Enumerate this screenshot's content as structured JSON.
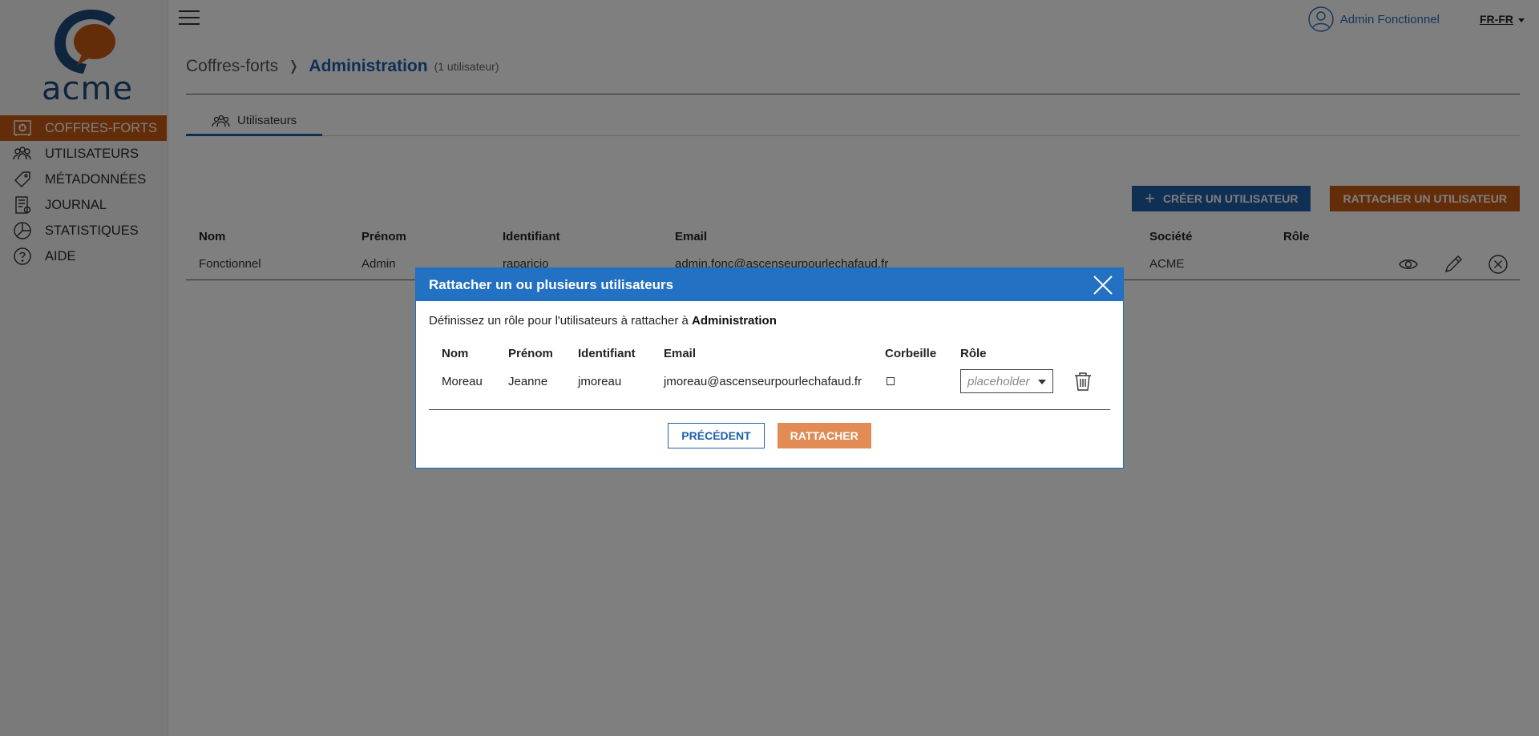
{
  "brand": {
    "name": "acme"
  },
  "sidebar": {
    "items": [
      {
        "label": "COFFRES-FORTS",
        "icon": "safe-icon",
        "active": true
      },
      {
        "label": "UTILISATEURS",
        "icon": "users-icon"
      },
      {
        "label": "MÉTADONNÉES",
        "icon": "tag-icon"
      },
      {
        "label": "JOURNAL",
        "icon": "journal-icon"
      },
      {
        "label": "STATISTIQUES",
        "icon": "pie-chart-icon"
      },
      {
        "label": "AIDE",
        "icon": "help-icon"
      }
    ]
  },
  "header": {
    "user_name": "Admin Fonctionnel",
    "language": "FR-FR"
  },
  "breadcrumb": {
    "root": "Coffres-forts",
    "separator": "❭",
    "current": "Administration",
    "count": "(1 utilisateur)"
  },
  "tabs": [
    {
      "label": "Utilisateurs",
      "icon": "users-icon"
    }
  ],
  "actions": {
    "create_label": "CRÉER UN UTILISATEUR",
    "attach_label": "RATTACHER UN UTILISATEUR"
  },
  "table": {
    "headers": [
      "Nom",
      "Prénom",
      "Identifiant",
      "Email",
      "Société",
      "Rôle"
    ],
    "rows": [
      {
        "nom": "Fonctionnel",
        "prenom": "Admin",
        "identifiant": "raparicio",
        "email": "admin.fonc@ascenseurpourlechafaud.fr",
        "societe": "ACME",
        "role": ""
      }
    ]
  },
  "modal": {
    "title": "Rattacher un ou plusieurs utilisateurs",
    "intro": "Définissez un rôle pour l'utilisateurs à rattacher à ",
    "intro_target": "Administration",
    "headers": [
      "Nom",
      "Prénom",
      "Identifiant",
      "Email",
      "Corbeille",
      "Rôle"
    ],
    "rows": [
      {
        "nom": "Moreau",
        "prenom": "Jeanne",
        "identifiant": "jmoreau",
        "email": "jmoreau@ascenseurpourlechafaud.fr",
        "corbeille": false,
        "role_placeholder": "placeholder"
      }
    ],
    "prev_label": "PRÉCÉDENT",
    "submit_label": "RATTACHER"
  },
  "colors": {
    "primary": "#1e5fa8",
    "accent": "#c95a12",
    "modal_header": "#2271c2"
  }
}
